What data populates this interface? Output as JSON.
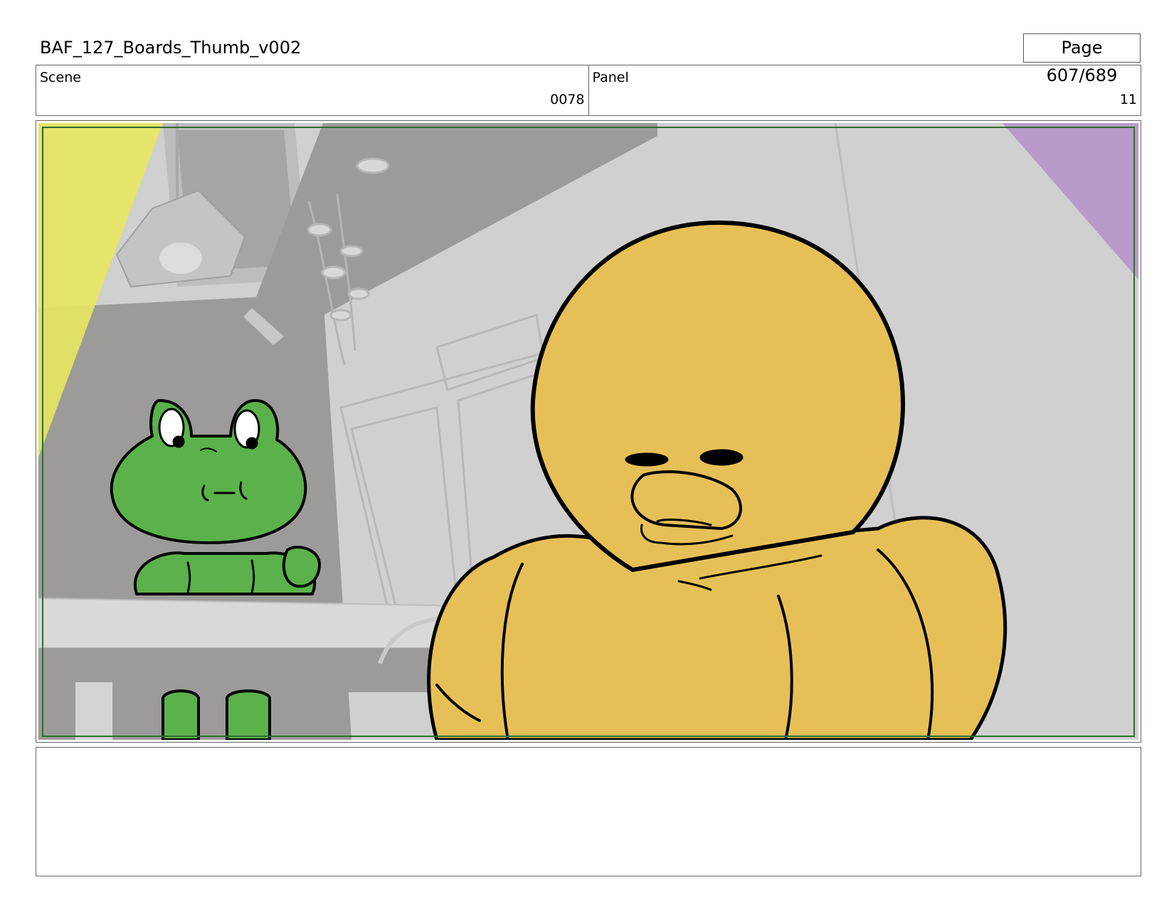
{
  "header": {
    "document_title": "BAF_127_Boards_Thumb_v002",
    "page_label": "Page 607/689"
  },
  "meta": {
    "scene_label": "Scene",
    "scene_value": "0078",
    "panel_label": "Panel",
    "panel_value": "11"
  },
  "notes": {
    "text": ""
  },
  "colors": {
    "wall": "#d0d0d0",
    "shadow": "#9c9b9a",
    "frog_green": "#5bb24a",
    "duck_yellow": "#e6c057",
    "light_yellow": "#e6e562",
    "light_purple": "#b89acb",
    "safe_frame": "#2e6e2e"
  }
}
